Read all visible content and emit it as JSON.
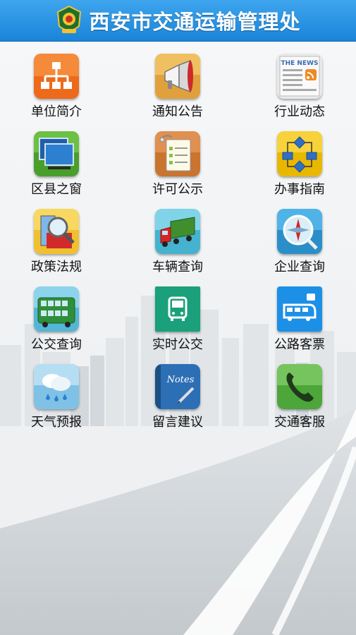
{
  "header": {
    "title": "西安市交通运输管理处"
  },
  "menu": [
    {
      "label": "单位简介",
      "icon": "org-chart-icon"
    },
    {
      "label": "通知公告",
      "icon": "megaphone-icon"
    },
    {
      "label": "行业动态",
      "icon": "news-icon"
    },
    {
      "label": "区县之窗",
      "icon": "windows-icon"
    },
    {
      "label": "许可公示",
      "icon": "clipboard-icon"
    },
    {
      "label": "办事指南",
      "icon": "flowchart-icon"
    },
    {
      "label": "政策法规",
      "icon": "policy-search-icon"
    },
    {
      "label": "车辆查询",
      "icon": "truck-icon"
    },
    {
      "label": "企业查询",
      "icon": "compass-icon"
    },
    {
      "label": "公交查询",
      "icon": "bus-query-icon"
    },
    {
      "label": "实时公交",
      "icon": "realtime-bus-icon"
    },
    {
      "label": "公路客票",
      "icon": "coach-ticket-icon"
    },
    {
      "label": "天气预报",
      "icon": "weather-icon"
    },
    {
      "label": "留言建议",
      "icon": "notes-icon"
    },
    {
      "label": "交通客服",
      "icon": "phone-icon"
    }
  ],
  "notes_text": "Notes",
  "news_text": "THE NEWS"
}
